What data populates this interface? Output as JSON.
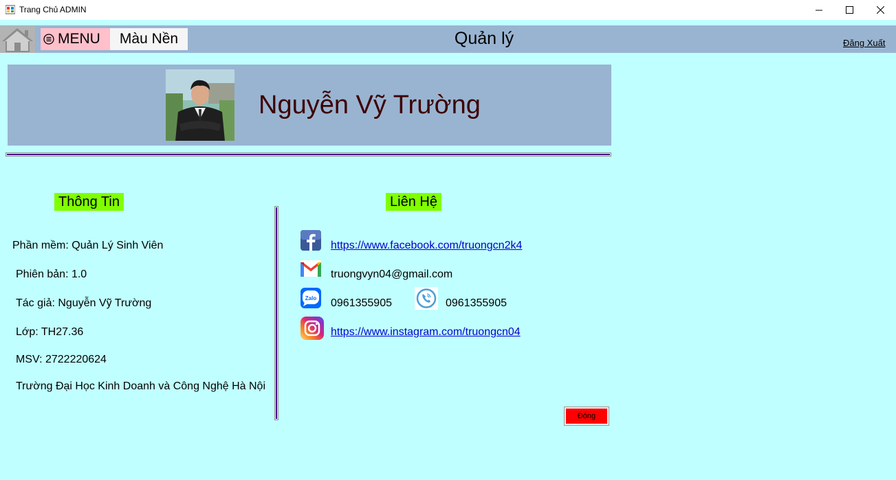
{
  "window": {
    "title": "Trang Chủ ADMIN"
  },
  "topbar": {
    "menu_label": "MENU",
    "color_label": "Màu Nền",
    "heading": "Quản lý",
    "logout_label": "Đăng Xuất"
  },
  "profile": {
    "name": "Nguyễn Vỹ Trường"
  },
  "info": {
    "title": "Thông Tin",
    "lines": [
      "Phần mềm: Quản Lý Sinh Viên",
      "Phiên bản: 1.0",
      "Tác giả: Nguyễn Vỹ Trường",
      "Lớp: TH27.36",
      "MSV: 2722220624",
      "Trường Đại Học Kinh Doanh và Công Nghệ Hà Nội"
    ]
  },
  "contact": {
    "title": "Liên Hệ",
    "facebook": "https://www.facebook.com/truongcn2k4",
    "email": "truongvyn04@gmail.com",
    "zalo_phone": "0961355905",
    "viber_phone": "0961355905",
    "instagram": "https://www.instagram.com/truongcn04",
    "zalo_icon_text": "Zalo"
  },
  "actions": {
    "close_label": "Đóng"
  },
  "colors": {
    "background": "#c0ffff",
    "bar": "#99b4d1",
    "menu": "#ffc0cb",
    "label_bg": "#80ff00",
    "close": "#ff0000",
    "divider": "#4b0082",
    "name": "#3d0000"
  }
}
